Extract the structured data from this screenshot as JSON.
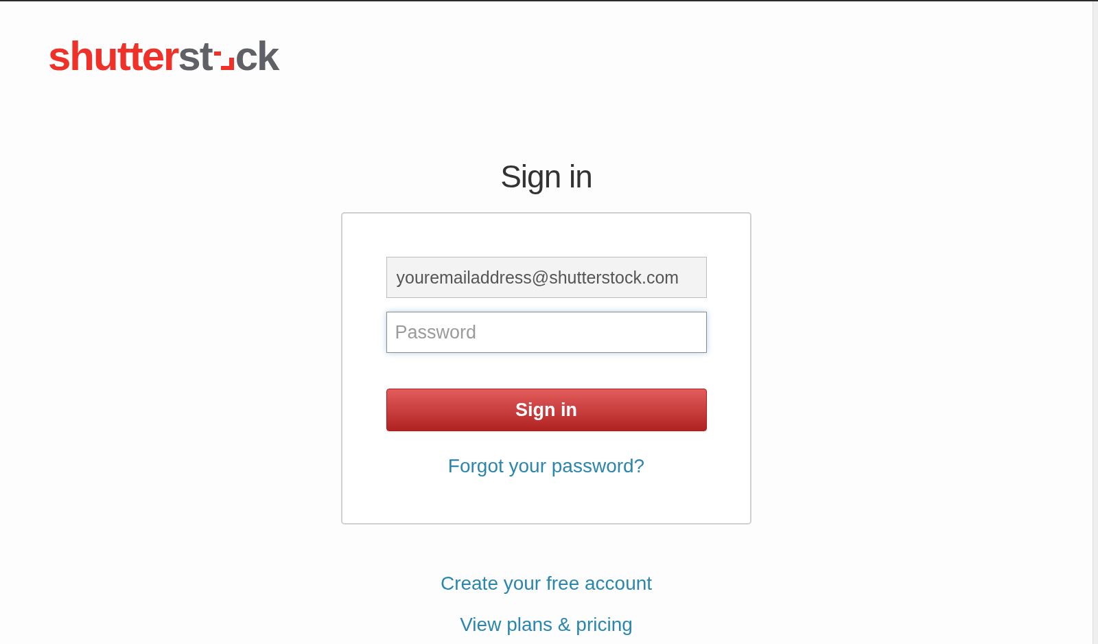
{
  "logo": {
    "segments": [
      {
        "kind": "text",
        "text": "shutter",
        "color": "#ee3129"
      },
      {
        "kind": "text",
        "text": "st",
        "color": "#5f6167"
      },
      {
        "kind": "mark",
        "color": "#ee3129"
      },
      {
        "kind": "text",
        "text": "ck",
        "color": "#5f6167"
      }
    ]
  },
  "title": "Sign in",
  "form": {
    "email": {
      "value": "youremailaddress@shutterstock.com",
      "autofilled": true
    },
    "password": {
      "placeholder": "Password",
      "focused": true
    },
    "submit_button": "Sign in",
    "forgot_link": "Forgot your password?"
  },
  "links": [
    "Create your free account",
    "View plans & pricing"
  ]
}
